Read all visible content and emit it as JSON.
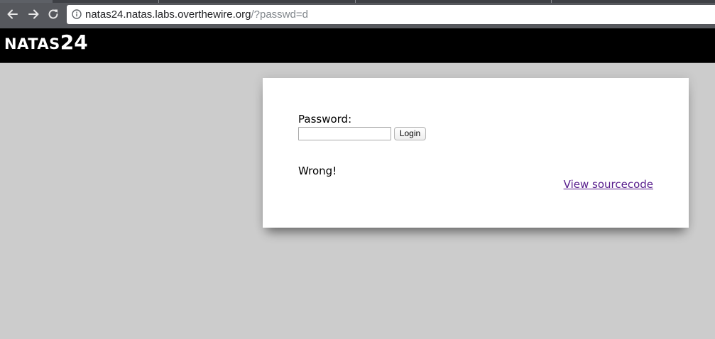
{
  "browser": {
    "url_host": "natas24.natas.labs.overthewire.org",
    "url_path": "/?passwd=d",
    "back_icon": "arrow-left-icon",
    "forward_icon": "arrow-right-icon",
    "reload_icon": "reload-icon",
    "info_icon": "info-icon",
    "chrome_color": "#56585d"
  },
  "header": {
    "title_prefix": "NATAS",
    "title_number": "24",
    "background": "#000000"
  },
  "form": {
    "password_label": "Password:",
    "password_value": "",
    "login_label": "Login"
  },
  "result": {
    "message": "Wrong!"
  },
  "footer_link": {
    "label": "View sourcecode",
    "color": "#551a8b"
  }
}
